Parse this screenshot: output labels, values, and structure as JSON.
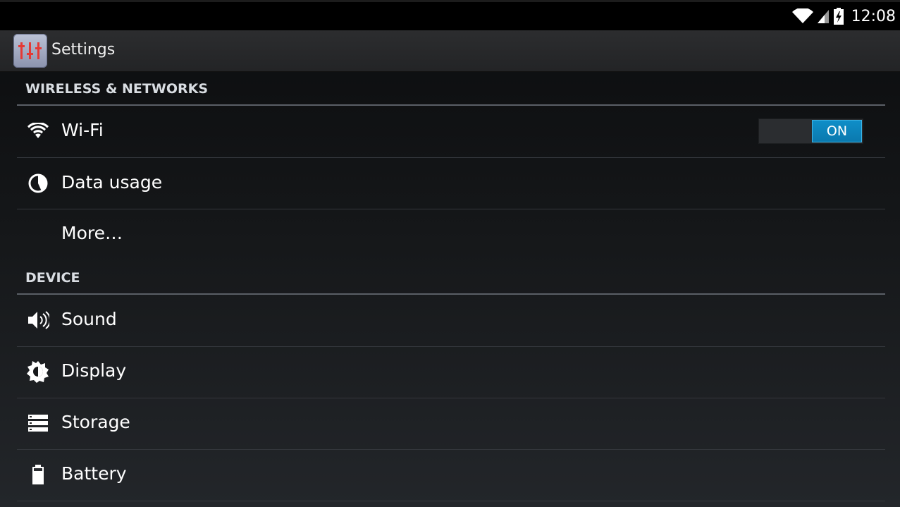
{
  "status_bar": {
    "time": "12:08",
    "icons": [
      "wifi-signal-icon",
      "cell-signal-icon",
      "battery-charging-icon"
    ]
  },
  "action_bar": {
    "app_icon": "settings-sliders-icon",
    "title": "Settings"
  },
  "sections": {
    "wireless": {
      "header": "WIRELESS & NETWORKS",
      "items": [
        {
          "label": "Wi-Fi",
          "icon": "wifi-icon",
          "toggle": "ON"
        },
        {
          "label": "Data usage",
          "icon": "data-usage-icon"
        },
        {
          "label": "More…",
          "icon": ""
        }
      ]
    },
    "device": {
      "header": "DEVICE",
      "items": [
        {
          "label": "Sound",
          "icon": "speaker-icon"
        },
        {
          "label": "Display",
          "icon": "brightness-icon"
        },
        {
          "label": "Storage",
          "icon": "storage-icon"
        },
        {
          "label": "Battery",
          "icon": "battery-icon"
        }
      ]
    }
  },
  "colors": {
    "accent": "#0f8fc9",
    "background_top": "#0b0c0e",
    "background_bottom": "#23262a",
    "divider": "#5a5f66"
  }
}
